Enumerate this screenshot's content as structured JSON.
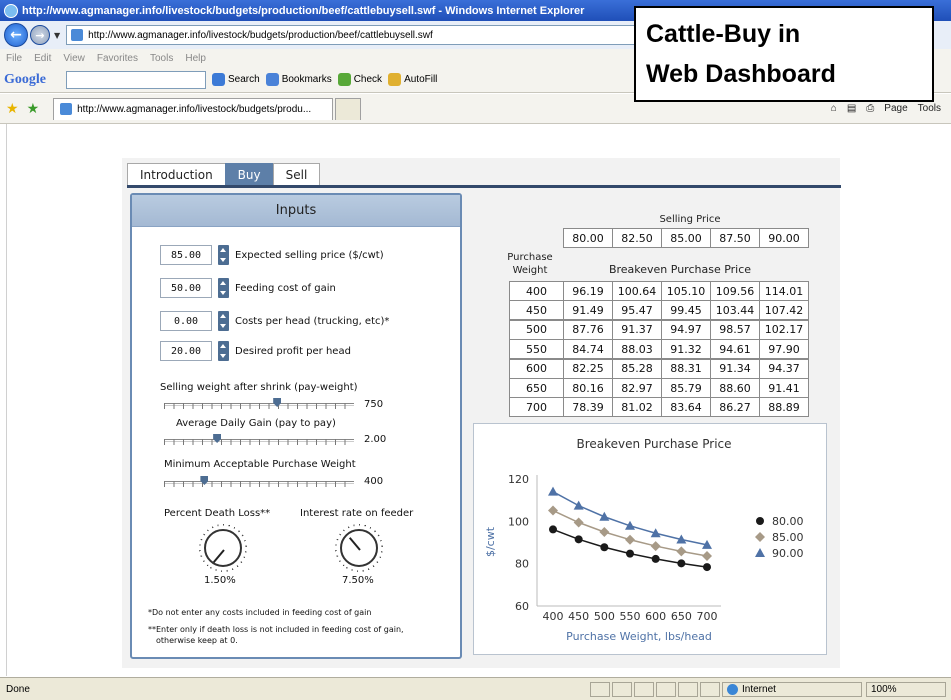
{
  "browser": {
    "title": "http://www.agmanager.info/livestock/budgets/production/beef/cattlebuysell.swf - Windows Internet Explorer",
    "address": "http://www.agmanager.info/livestock/budgets/production/beef/cattlebuysell.swf",
    "menu": [
      "File",
      "Edit",
      "View",
      "Favorites",
      "Tools",
      "Help"
    ],
    "google_label": "Google",
    "toolbar": {
      "search": "Search",
      "bookmarks": "Bookmarks",
      "check": "Check",
      "autofill": "AutoFill"
    },
    "tab_title": "http://www.agmanager.info/livestock/budgets/produ...",
    "page_menu": "Page",
    "tools_menu": "Tools",
    "status_done": "Done",
    "status_zone": "Internet",
    "zoom": "100%"
  },
  "overlay": {
    "line1": "Cattle-Buy in",
    "line2": "Web Dashboard"
  },
  "app_tabs": [
    "Introduction",
    "Buy",
    "Sell"
  ],
  "active_tab": "Buy",
  "inputs": {
    "header": "Inputs",
    "fields": [
      {
        "value": "85.00",
        "label": "Expected selling price ($/cwt)"
      },
      {
        "value": "50.00",
        "label": "Feeding cost of gain"
      },
      {
        "value": "0.00",
        "label": "Costs per head (trucking, etc)*"
      },
      {
        "value": "20.00",
        "label": "Desired profit per head"
      }
    ],
    "sliders": [
      {
        "label": "Selling weight after shrink (pay-weight)",
        "value": "750",
        "level": 0.6
      },
      {
        "label": "Average Daily Gain  (pay to pay)",
        "value": "2.00",
        "level": 0.27
      },
      {
        "label": "Minimum Acceptable Purchase Weight",
        "value": "400",
        "level": 0.2
      }
    ],
    "knobs": [
      {
        "label": "Percent Death Loss**",
        "value": "1.50%"
      },
      {
        "label": "Interest rate on feeder",
        "value": "7.50%"
      }
    ],
    "note1": "*Do not enter any costs included in feeding cost of gain",
    "note2a": "**Enter only if death loss is not included in feeding cost of gain,",
    "note2b": "otherwise keep at 0."
  },
  "table": {
    "selling_price_label": "Selling Price",
    "purchase_weight_label_1": "Purchase",
    "purchase_weight_label_2": "Weight",
    "breakeven_label": "Breakeven Purchase Price",
    "selling_prices": [
      "80.00",
      "82.50",
      "85.00",
      "87.50",
      "90.00"
    ],
    "rows": [
      {
        "weight": "400",
        "values": [
          "96.19",
          "100.64",
          "105.10",
          "109.56",
          "114.01"
        ]
      },
      {
        "weight": "450",
        "values": [
          "91.49",
          "95.47",
          "99.45",
          "103.44",
          "107.42"
        ]
      },
      {
        "weight": "500",
        "values": [
          "87.76",
          "91.37",
          "94.97",
          "98.57",
          "102.17"
        ]
      },
      {
        "weight": "550",
        "values": [
          "84.74",
          "88.03",
          "91.32",
          "94.61",
          "97.90"
        ]
      },
      {
        "weight": "600",
        "values": [
          "82.25",
          "85.28",
          "88.31",
          "91.34",
          "94.37"
        ]
      },
      {
        "weight": "650",
        "values": [
          "80.16",
          "82.97",
          "85.79",
          "88.60",
          "91.41"
        ]
      },
      {
        "weight": "700",
        "values": [
          "78.39",
          "81.02",
          "83.64",
          "86.27",
          "88.89"
        ]
      }
    ]
  },
  "chart_data": {
    "type": "line",
    "title": "Breakeven Purchase Price",
    "xlabel": "Purchase Weight, lbs/head",
    "ylabel": "$/cwt",
    "x": [
      400,
      450,
      500,
      550,
      600,
      650,
      700
    ],
    "yticks": [
      60,
      80,
      100,
      120
    ],
    "ylim": [
      60,
      120
    ],
    "grid": false,
    "legend": "right",
    "series": [
      {
        "name": "80.00",
        "marker": "circle",
        "color": "#1a1a1a",
        "values": [
          96.19,
          91.49,
          87.76,
          84.74,
          82.25,
          80.16,
          78.39
        ]
      },
      {
        "name": "85.00",
        "marker": "diamond",
        "color": "#a79a87",
        "values": [
          105.1,
          99.45,
          94.97,
          91.32,
          88.31,
          85.79,
          83.64
        ]
      },
      {
        "name": "90.00",
        "marker": "triangle",
        "color": "#4f72a6",
        "values": [
          114.01,
          107.42,
          102.17,
          97.9,
          94.37,
          91.41,
          88.89
        ]
      }
    ]
  }
}
